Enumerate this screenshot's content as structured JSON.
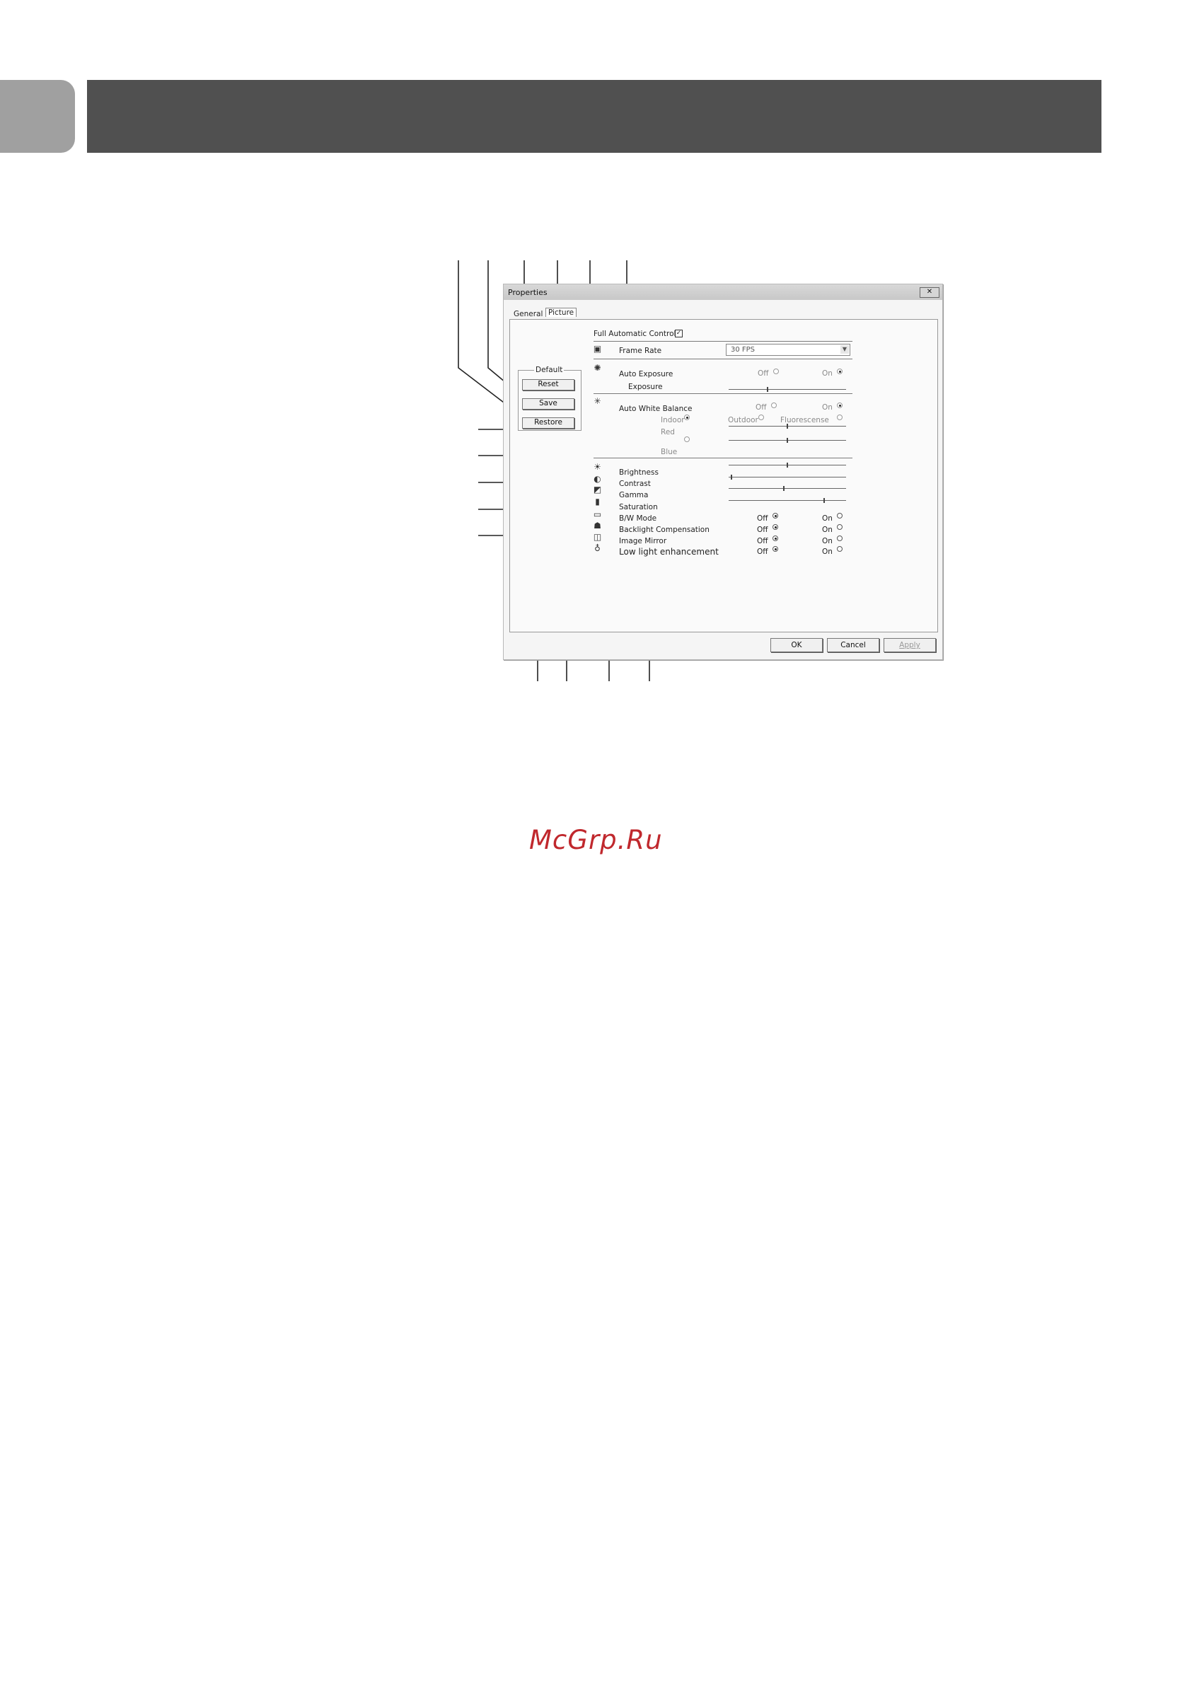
{
  "dialog": {
    "title": "Properties",
    "close_label": "✕",
    "tabs": [
      {
        "label": "General"
      },
      {
        "label": "Picture"
      }
    ]
  },
  "default_group": {
    "label": "Default",
    "buttons": [
      {
        "label": "Reset"
      },
      {
        "label": "Save"
      },
      {
        "label": "Restore"
      }
    ]
  },
  "full_auto": {
    "label": "Full Automatic Control",
    "checked": true,
    "check_glyph": "✓"
  },
  "frame_rate": {
    "label": "Frame Rate",
    "value": "30 FPS",
    "icon": "frame-rate-icon"
  },
  "auto_exposure": {
    "label": "Auto Exposure",
    "off": "Off",
    "on": "On",
    "selected": "On",
    "exposure_label": "Exposure",
    "exposure_value": 0.33,
    "icon": "exposure-icon"
  },
  "white_balance": {
    "label": "Auto White Balance",
    "off": "Off",
    "on": "On",
    "selected": "On",
    "indoor": "Indoor",
    "outdoor": "Outdoor",
    "fluorescense": "Fluorescense",
    "red_label": "Red",
    "blue_label": "Blue",
    "red_value": 0.5,
    "blue_value": 0.5,
    "icon": "white-balance-icon"
  },
  "sliders": [
    {
      "label": "Brightness",
      "value": 0.5,
      "icon": "brightness-icon"
    },
    {
      "label": "Contrast",
      "value": 0.02,
      "icon": "contrast-icon"
    },
    {
      "label": "Gamma",
      "value": 0.47,
      "icon": "gamma-icon"
    },
    {
      "label": "Saturation",
      "value": 0.82,
      "icon": "saturation-icon"
    }
  ],
  "toggles": [
    {
      "label": "B/W Mode",
      "off": "Off",
      "on": "On",
      "selected": "Off",
      "icon": "bw-mode-icon"
    },
    {
      "label": "Backlight Compensation",
      "off": "Off",
      "on": "On",
      "selected": "Off",
      "icon": "backlight-icon"
    },
    {
      "label": "Image Mirror",
      "off": "Off",
      "on": "On",
      "selected": "Off",
      "icon": "mirror-icon"
    },
    {
      "label": "Low light enhancement",
      "off": "Off",
      "on": "On",
      "selected": "Off",
      "icon": "lightbulb-icon"
    }
  ],
  "footer": {
    "ok": "OK",
    "cancel": "Cancel",
    "apply": "Apply"
  },
  "watermark": "McGrp.Ru"
}
